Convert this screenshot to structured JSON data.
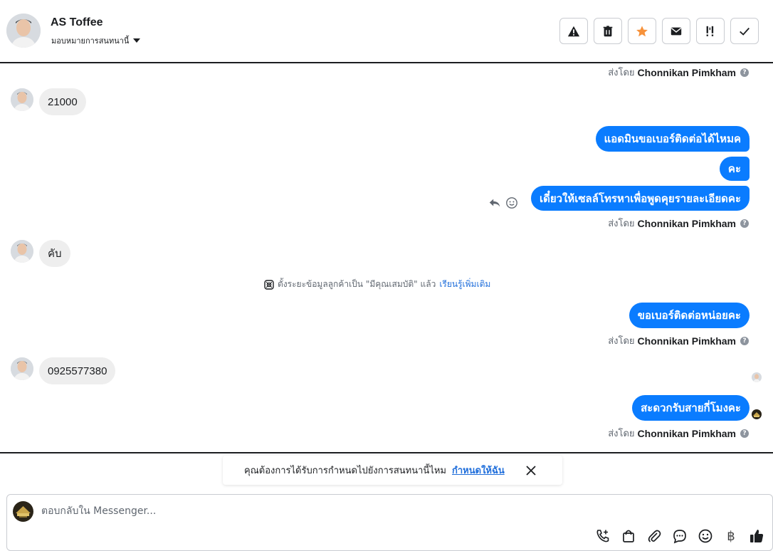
{
  "header": {
    "contact_name": "AS Toffee",
    "assign_label": "มอบหมายการสนทนานี้",
    "actions": [
      "spam-icon",
      "trash-icon",
      "star-icon",
      "mail-icon",
      "follow-up-icon",
      "done-icon"
    ],
    "star_color": "#f7923b"
  },
  "chat": {
    "sent_by_prefix": "ส่งโดย",
    "sent_by_name": "Chonnikan Pimkham",
    "incoming": [
      "21000",
      "คับ",
      "0925577380"
    ],
    "outgoing": [
      "แอดมินขอเบอร์ติดต่อได้ไหมค",
      "คะ",
      "เดี๋ยวให้เซลล์โทรหาเพื่อพูดคุยรายละเอียดคะ",
      "ขอเบอร์ติดต่อหน่อยคะ",
      "สะดวกรับสายกี่โมงคะ"
    ],
    "system_note": "ตั้งระยะข้อมูลลูกค้าเป็น \"มีคุณเสมบัติ\" แล้ว",
    "system_link": "เรียนรู้เพิ่มเติม"
  },
  "assign_prompt": {
    "text": "คุณต้องการได้รับการกำหนดไปยังการสนทนานี้ไหม",
    "link": "กำหนดให้ฉัน"
  },
  "composer": {
    "placeholder": "ตอบกลับใน Messenger...",
    "tools": [
      "call-add-icon",
      "shop-bag-icon",
      "attach-icon",
      "chat-bubble-icon",
      "emoji-icon",
      "baht-icon",
      "thumbs-up-icon"
    ],
    "baht_symbol": "฿"
  },
  "colors": {
    "brand": "#0a7cff",
    "incoming_bubble": "#eeeeee",
    "link": "#216fdb"
  }
}
